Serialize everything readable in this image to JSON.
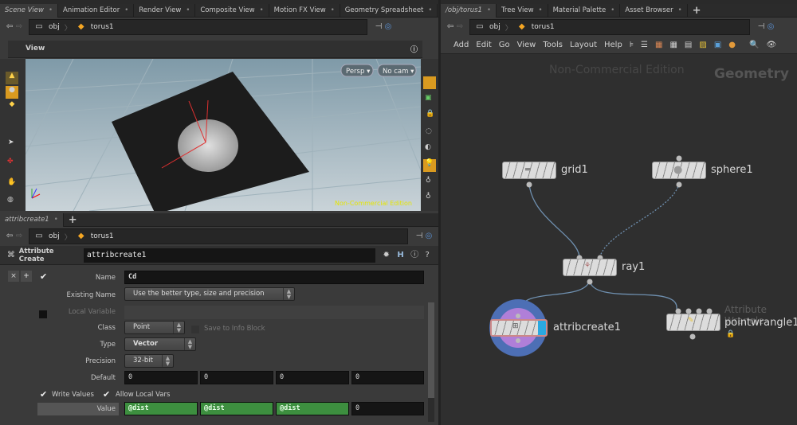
{
  "left_tabs": [
    "Scene View",
    "Animation Editor",
    "Render View",
    "Composite View",
    "Motion FX View",
    "Geometry Spreadsheet"
  ],
  "right_tabs": [
    "/obj/torus1",
    "Tree View",
    "Material Palette",
    "Asset Browser"
  ],
  "path": {
    "root": "obj",
    "node": "torus1"
  },
  "viewer": {
    "title": "View",
    "persp": "Persp ▾",
    "cam": "No cam ▾",
    "watermark": "Non-Commercial Edition"
  },
  "param_tab": "attribcreate1",
  "params": {
    "node_type": "Attribute Create",
    "node_name": "attribcreate1",
    "name_label": "Name",
    "name_value": "Cd",
    "existing_label": "Existing Name",
    "existing_value": "Use the better type, size and precision",
    "localvar_label": "Local Variable",
    "class_label": "Class",
    "class_value": "Point",
    "save_info": "Save to Info Block",
    "type_label": "Type",
    "type_value": "Vector",
    "precision_label": "Precision",
    "precision_value": "32-bit",
    "default_label": "Default",
    "defaults": [
      "0",
      "0",
      "0",
      "0"
    ],
    "write_values": "Write Values",
    "allow_local": "Allow Local Vars",
    "value_label": "Value",
    "values": [
      "@dist",
      "@dist",
      "@dist",
      "0"
    ]
  },
  "network": {
    "menu": [
      "Add",
      "Edit",
      "Go",
      "View",
      "Tools",
      "Layout",
      "Help"
    ],
    "watermark": "Non-Commercial Edition",
    "context": "Geometry",
    "nodes": {
      "grid": "grid1",
      "sphere": "sphere1",
      "ray": "ray1",
      "attribcreate": "attribcreate1",
      "wrangle": "pointwrangle1",
      "wrangle_type": "Attribute Wrangle"
    }
  },
  "colors": {
    "selected_param": "#3d8f3f",
    "display_flag": "#2aa8e0",
    "selection_ring": "#4d6fb5"
  }
}
